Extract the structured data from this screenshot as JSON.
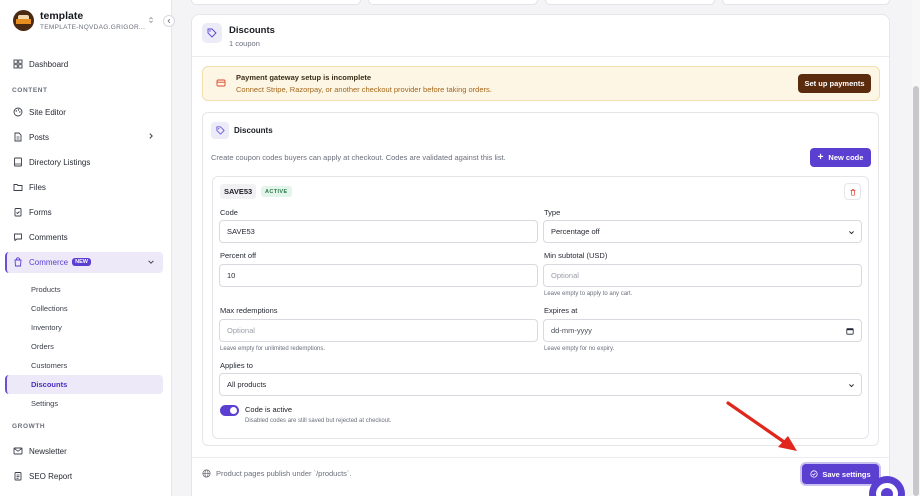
{
  "app": {
    "name": "template",
    "subtitle": "TEMPLATE-NQVDAG.GRIGOR..."
  },
  "sidebar": {
    "dashboard": "Dashboard",
    "section_content": "CONTENT",
    "site_editor": "Site Editor",
    "posts": "Posts",
    "directory_listings": "Directory Listings",
    "files": "Files",
    "forms": "Forms",
    "comments": "Comments",
    "commerce": "Commerce",
    "commerce_badge": "NEW",
    "commerce_items": [
      "Products",
      "Collections",
      "Inventory",
      "Orders",
      "Customers",
      "Discounts",
      "Settings"
    ],
    "section_growth": "GROWTH",
    "newsletter": "Newsletter",
    "seo_report": "SEO Report"
  },
  "header": {
    "title": "Discounts",
    "subtitle": "1 coupon"
  },
  "alert": {
    "title": "Payment gateway setup is incomplete",
    "text": "Connect Stripe, Razorpay, or another checkout provider before taking orders.",
    "button": "Set up payments"
  },
  "discounts": {
    "title": "Discounts",
    "description": "Create coupon codes buyers can apply at checkout. Codes are validated against this list.",
    "new_button": "New code"
  },
  "coupon": {
    "code_badge": "SAVE53",
    "status": "ACTIVE",
    "code_label": "Code",
    "code_value": "SAVE53",
    "type_label": "Type",
    "type_value": "Percentage off",
    "percent_label": "Percent off",
    "percent_value": "10",
    "min_label": "Min subtotal (USD)",
    "min_placeholder": "Optional",
    "min_hint": "Leave empty to apply to any cart.",
    "max_label": "Max redemptions",
    "max_placeholder": "Optional",
    "max_hint": "Leave empty for unlimited redemptions.",
    "expires_label": "Expires at",
    "expires_placeholder": "dd-mm-yyyy",
    "expires_hint": "Leave empty for no expiry.",
    "applies_label": "Applies to",
    "applies_value": "All products",
    "active_label": "Code is active",
    "active_hint": "Disabled codes are still saved but rejected at checkout.",
    "active": true
  },
  "footer": {
    "note": "Product pages publish under `/products`.",
    "save_button": "Save settings"
  },
  "colors": {
    "accent": "#5b3fd1",
    "warning_bg": "#fdf6e5",
    "warning_text": "#a4661a",
    "payments_button": "#5b2b0e",
    "arrow": "#e0261d"
  }
}
